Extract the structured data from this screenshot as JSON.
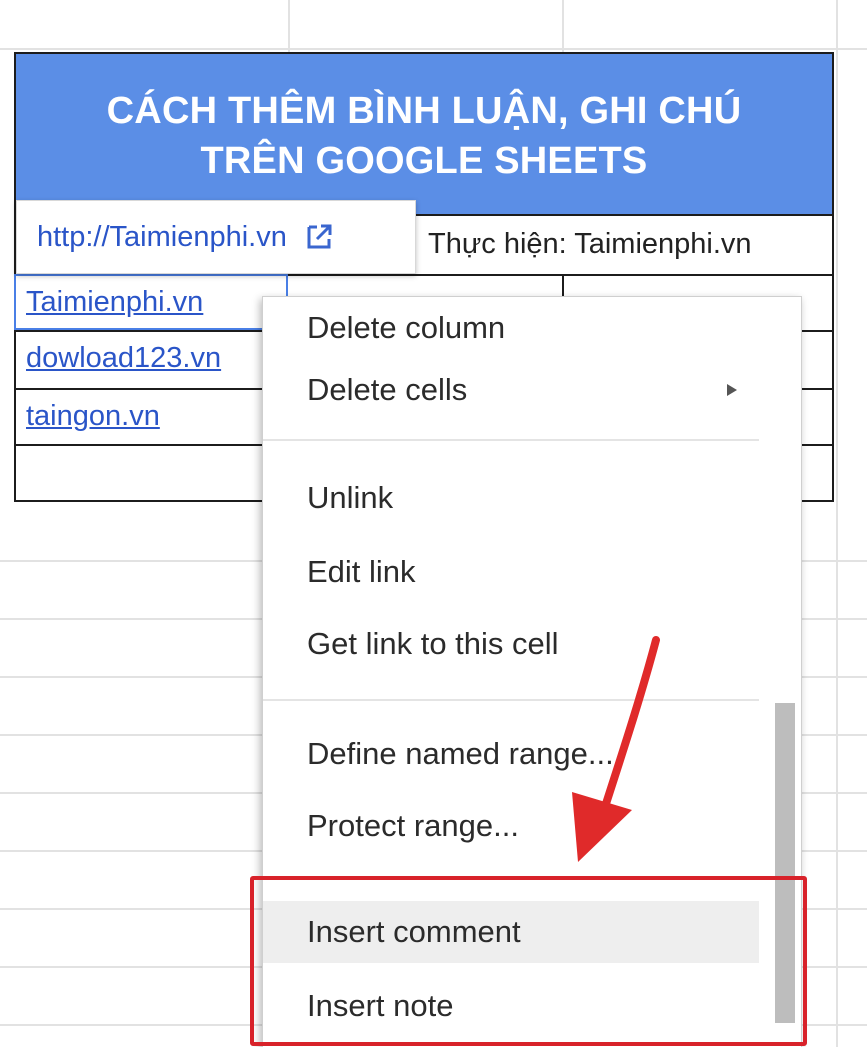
{
  "sheet": {
    "title_line1": "CÁCH THÊM BÌNH LUẬN, GHI CHÚ",
    "title_line2": "TRÊN GOOGLE SHEETS",
    "performer_label": "Thực hiện: Taimienphi.vn",
    "links": [
      "Taimienphi.vn",
      "dowload123.vn",
      "taingon.vn"
    ],
    "title_bg_color": "#5b8ee6"
  },
  "link_tooltip": {
    "url": "http://Taimienphi.vn",
    "icon": "open-in-new-icon"
  },
  "context_menu": {
    "items": [
      {
        "label": "Delete column"
      },
      {
        "label": "Delete cells",
        "submenu_icon": "submenu-arrow-icon"
      },
      {
        "label": "Unlink"
      },
      {
        "label": "Edit link"
      },
      {
        "label": "Get link to this cell"
      },
      {
        "label": "Define named range..."
      },
      {
        "label": "Protect range..."
      },
      {
        "label": "Insert comment",
        "highlighted": true
      },
      {
        "label": "Insert note"
      }
    ]
  },
  "annotation": {
    "highlight_color": "#d8222a",
    "arrow_color": "#e02a2a"
  }
}
